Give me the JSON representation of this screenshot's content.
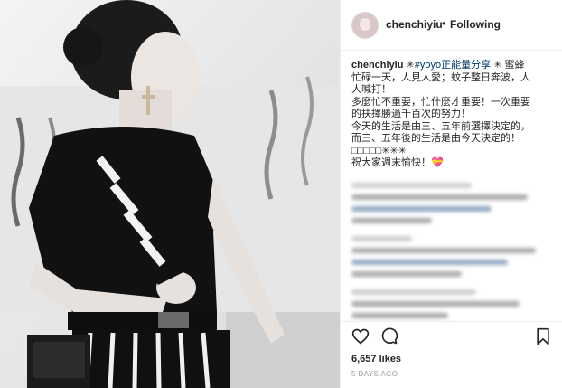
{
  "post": {
    "username": "chenchiyiu",
    "separator": "•",
    "follow_status": "Following"
  },
  "caption": {
    "username": "chenchiyiu",
    "lead": " ✳︎",
    "hashtag": "#yoyo正能量分享",
    "line1": " ✳︎ 蜜蜂忙碌一天，人見人愛；蚊子整日奔波，人人喊打！",
    "line2": "多麼忙不重要，忙什麼才重要！一次重要的抉擇勝過千百次的努力！",
    "line3": "今天的生活是由三、五年前選擇決定的，而三、五年後的生活是由今天決定的！□□□□□✳︎✳︎✳︎",
    "line4": "祝大家週末愉快！💝"
  },
  "comments_blurred": true,
  "actions": {
    "like_icon": "heart-icon",
    "comment_icon": "speech-bubble-icon",
    "save_icon": "bookmark-icon"
  },
  "likes_text": "6,657 likes",
  "date_text": "5 DAYS AGO"
}
